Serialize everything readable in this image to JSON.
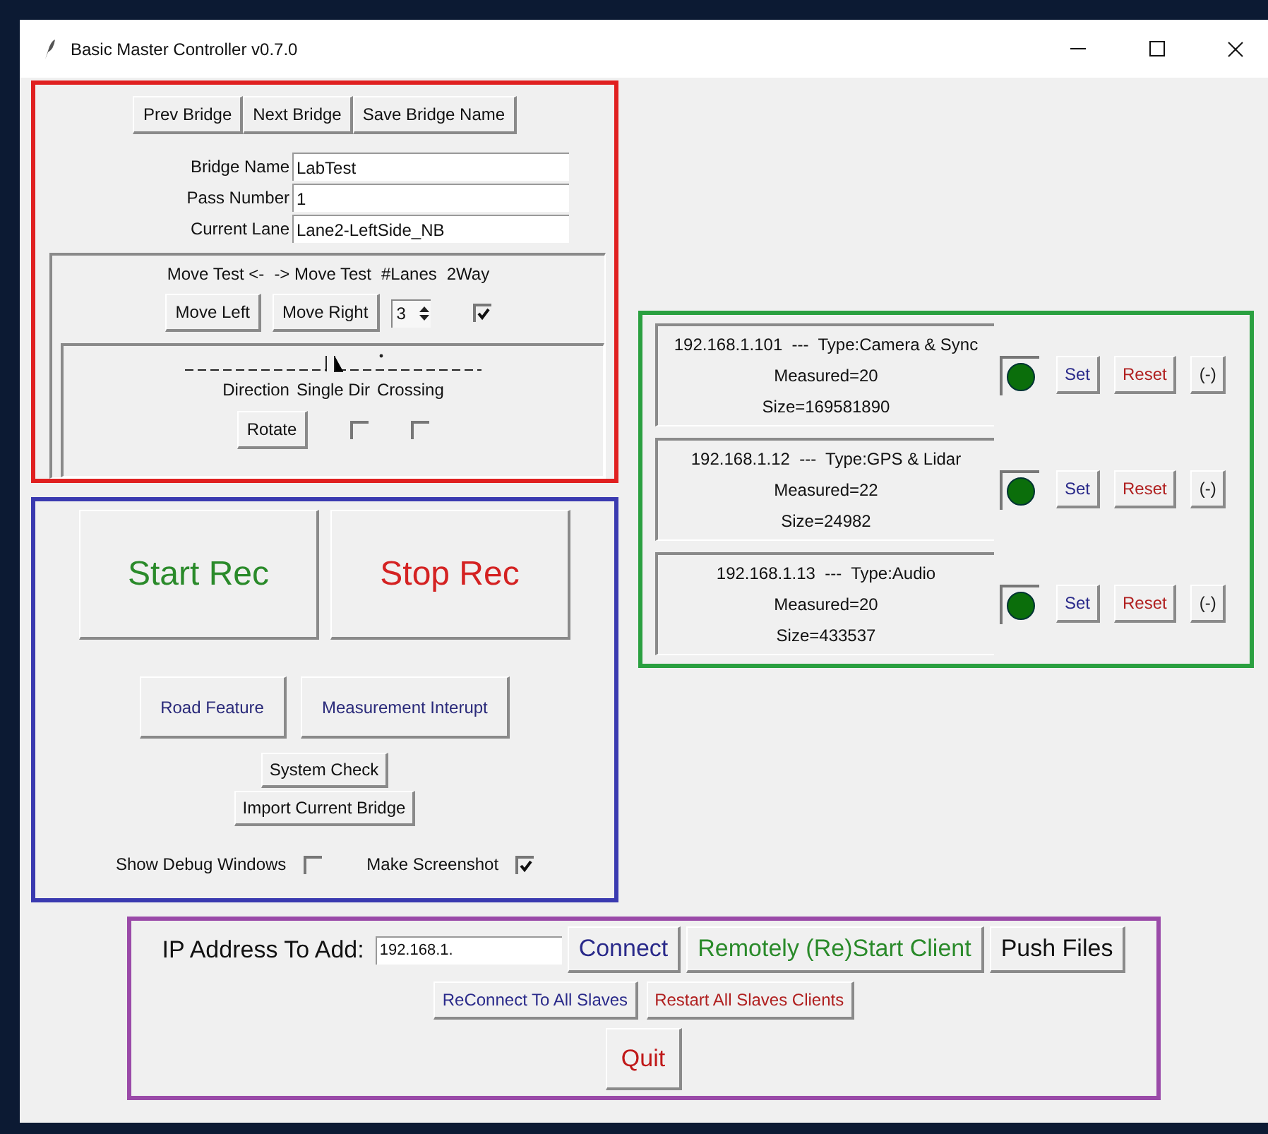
{
  "window": {
    "title": "Basic Master Controller v0.7.0"
  },
  "bridge_panel": {
    "nav_buttons": [
      "Prev Bridge",
      "Next Bridge",
      "Save Bridge Name"
    ],
    "fields": [
      {
        "label": "Bridge Name",
        "value": "LabTest"
      },
      {
        "label": "Pass Number",
        "value": "1"
      },
      {
        "label": "Current Lane",
        "value": "Lane2-LeftSide_NB"
      }
    ],
    "move_headers": [
      "Move Test <-",
      "-> Move Test",
      "#Lanes",
      "2Way"
    ],
    "move_buttons": [
      "Move Left",
      "Move Right"
    ],
    "lanes": "3",
    "two_way_checked": true,
    "direction_headers": [
      "Direction",
      "Single Dir",
      "Crossing"
    ],
    "rotate_button": "Rotate",
    "single_dir_checked": false,
    "crossing_checked": false
  },
  "recording_panel": {
    "big_buttons": [
      {
        "label": "Start Rec",
        "color": "#2a8a2a"
      },
      {
        "label": "Stop Rec",
        "color": "#d42222"
      }
    ],
    "feature_buttons": [
      "Road Feature",
      "Measurement Interupt"
    ],
    "system_check": "System Check",
    "import_button": "Import Current Bridge",
    "options": [
      {
        "label": "Show Debug Windows",
        "checked": false
      },
      {
        "label": "Make Screenshot",
        "checked": true
      }
    ]
  },
  "clients": [
    {
      "title": "192.168.1.101  ---  Type:Camera & Sync",
      "measured": "Measured=20",
      "size": "Size=169581890",
      "buttons": [
        {
          "label": "Set",
          "color": "#2a2a8a"
        },
        {
          "label": "Reset",
          "color": "#b02020"
        },
        {
          "label": "(-)",
          "color": "#222222"
        }
      ]
    },
    {
      "title": "192.168.1.12  ---  Type:GPS & Lidar",
      "measured": "Measured=22",
      "size": "Size=24982",
      "buttons": [
        {
          "label": "Set",
          "color": "#2a2a8a"
        },
        {
          "label": "Reset",
          "color": "#b02020"
        },
        {
          "label": "(-)",
          "color": "#222222"
        }
      ]
    },
    {
      "title": "192.168.1.13  ---  Type:Audio",
      "measured": "Measured=20",
      "size": "Size=433537",
      "buttons": [
        {
          "label": "Set",
          "color": "#2a2a8a"
        },
        {
          "label": "Reset",
          "color": "#b02020"
        },
        {
          "label": "(-)",
          "color": "#222222"
        }
      ]
    }
  ],
  "connect_panel": {
    "ip_label": "IP Address To Add:",
    "ip_value": "192.168.1.",
    "buttons": [
      {
        "label": "Connect",
        "color": "#2a2a8a"
      },
      {
        "label": "Remotely (Re)Start Client",
        "color": "#2a8a2a"
      },
      {
        "label": "Push Files",
        "color": "#111111"
      }
    ],
    "slave_buttons": [
      {
        "label": "ReConnect To All Slaves",
        "color": "#2a2a8a"
      },
      {
        "label": "Restart All Slaves Clients",
        "color": "#b02020"
      }
    ],
    "quit": {
      "label": "Quit",
      "color": "#c01818"
    }
  }
}
